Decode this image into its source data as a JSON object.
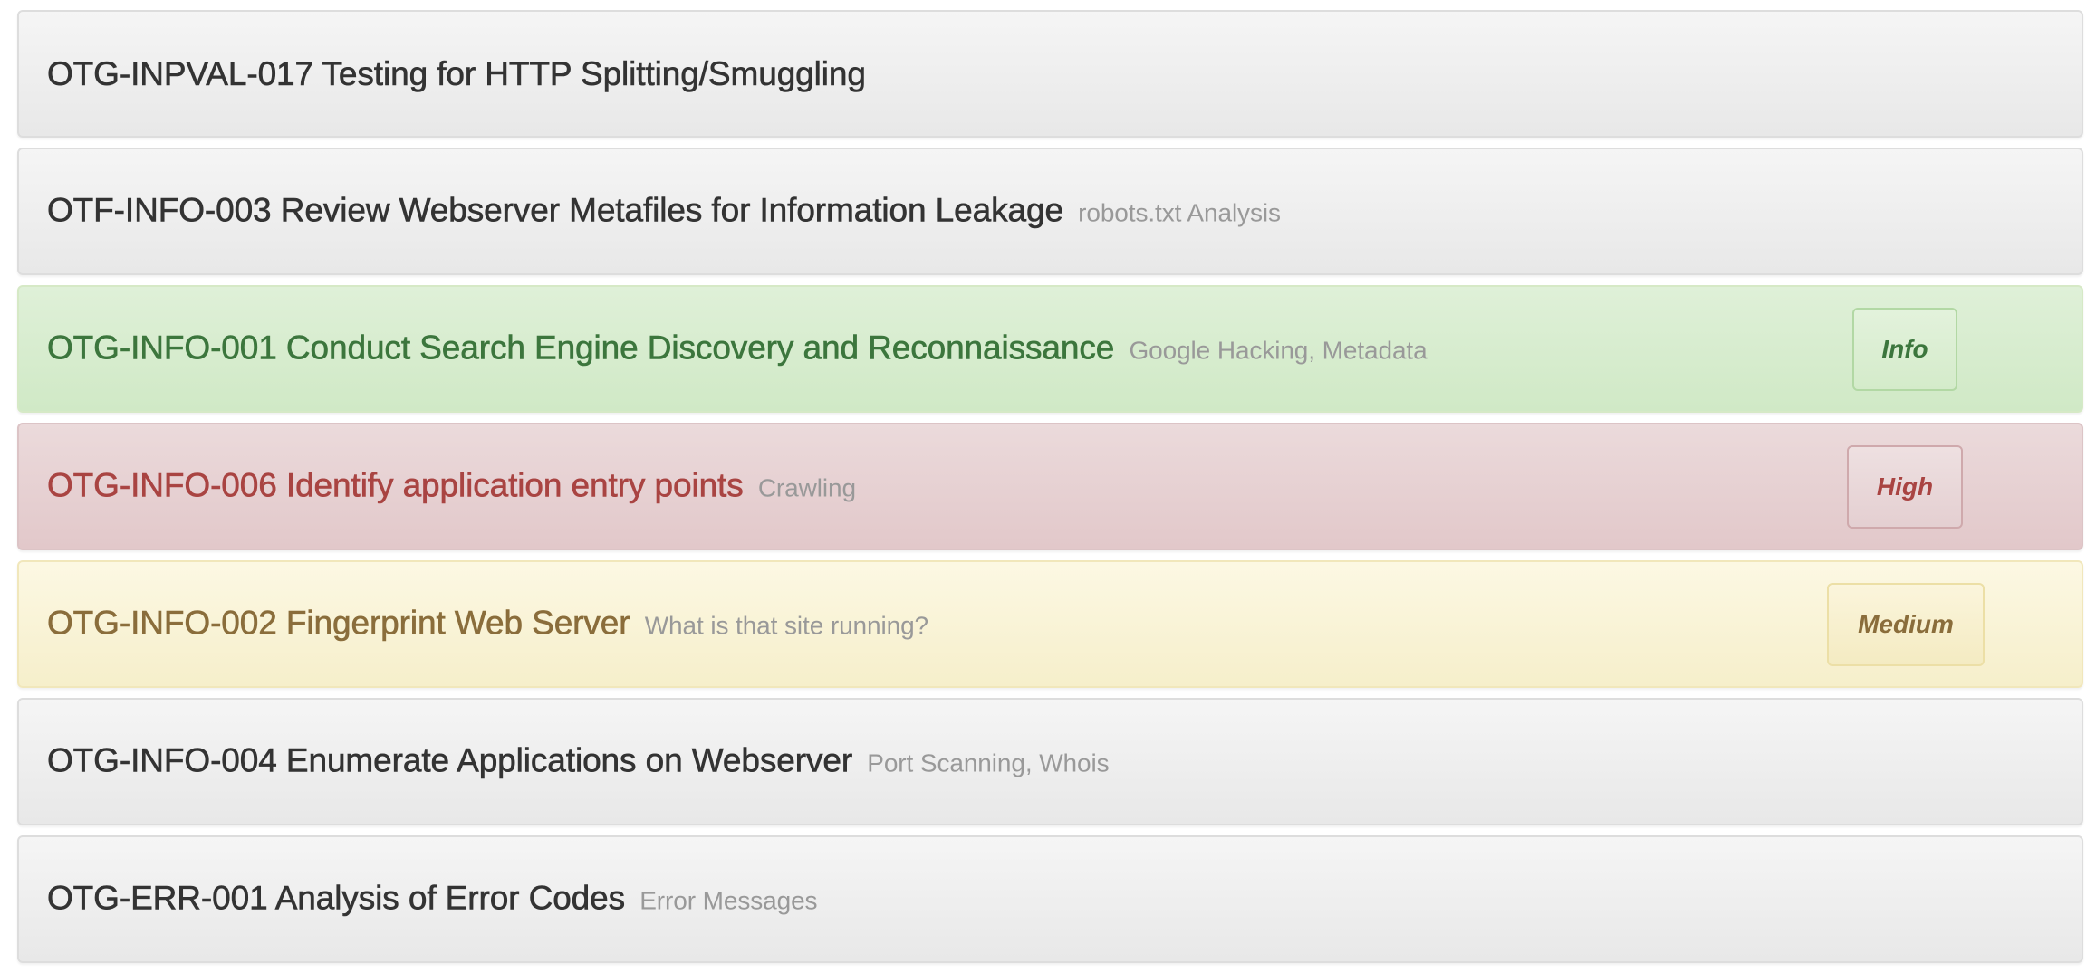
{
  "items": [
    {
      "code_title": "OTG-INPVAL-017 Testing for HTTP Splitting/Smuggling",
      "subtitle": "",
      "severity": "",
      "state": "default"
    },
    {
      "code_title": "OTF-INFO-003 Review Webserver Metafiles for Information Leakage",
      "subtitle": "robots.txt Analysis",
      "severity": "",
      "state": "default"
    },
    {
      "code_title": "OTG-INFO-001 Conduct Search Engine Discovery and Reconnaissance",
      "subtitle": "Google Hacking, Metadata",
      "severity": "Info",
      "state": "success"
    },
    {
      "code_title": "OTG-INFO-006 Identify application entry points",
      "subtitle": "Crawling",
      "severity": "High",
      "state": "danger"
    },
    {
      "code_title": "OTG-INFO-002 Fingerprint Web Server",
      "subtitle": "What is that site running?",
      "severity": "Medium",
      "state": "warning"
    },
    {
      "code_title": "OTG-INFO-004 Enumerate Applications on Webserver",
      "subtitle": "Port Scanning, Whois",
      "severity": "",
      "state": "default"
    },
    {
      "code_title": "OTG-ERR-001 Analysis of Error Codes",
      "subtitle": "Error Messages",
      "severity": "",
      "state": "default"
    }
  ],
  "colors": {
    "default_text": "#333333",
    "subtitle_text": "#999999",
    "success_text": "#3c763d",
    "danger_text": "#a94442",
    "warning_text": "#8a6d3b",
    "success_bg": "#dff0d8",
    "danger_bg": "#ebdadb",
    "warning_bg": "#fcf8e3",
    "default_bg": "#f5f5f5"
  }
}
